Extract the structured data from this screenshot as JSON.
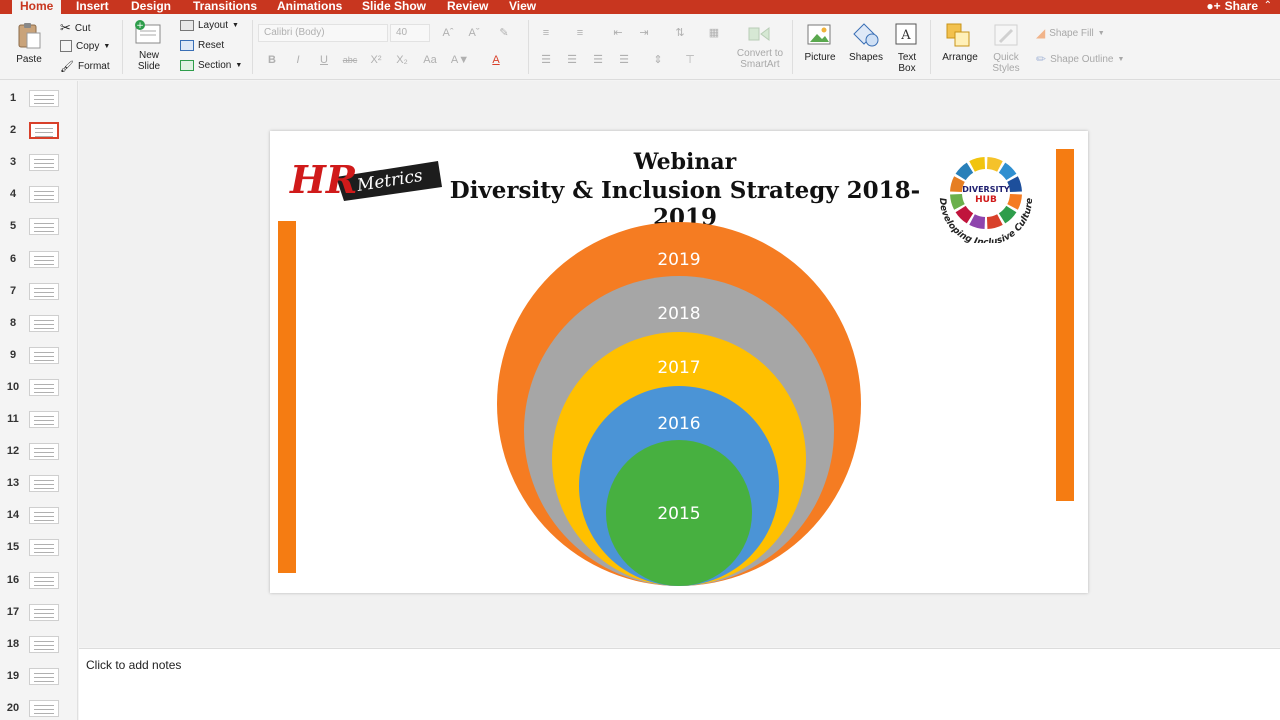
{
  "ribbon_tabs": [
    {
      "label": "Home",
      "active": true
    },
    {
      "label": "Insert"
    },
    {
      "label": "Design"
    },
    {
      "label": "Transitions"
    },
    {
      "label": "Animations"
    },
    {
      "label": "Slide Show"
    },
    {
      "label": "Review"
    },
    {
      "label": "View"
    }
  ],
  "share_label": "Share",
  "clipboard": {
    "paste": "Paste",
    "cut": "Cut",
    "copy": "Copy",
    "format": "Format"
  },
  "slides_group": {
    "new_slide": "New Slide",
    "layout": "Layout",
    "reset": "Reset",
    "section": "Section"
  },
  "font": {
    "name": "Calibri (Body)",
    "size": "40"
  },
  "format_buttons": [
    "B",
    "I",
    "U",
    "abc",
    "X²",
    "X₂"
  ],
  "convert_smartart": "Convert to SmartArt",
  "insert_group": {
    "picture": "Picture",
    "shapes": "Shapes",
    "text_box": "Text Box"
  },
  "drawing_group": {
    "arrange": "Arrange",
    "quick_styles": "Quick Styles",
    "shape_fill": "Shape Fill",
    "shape_outline": "Shape Outline"
  },
  "thumbnails": [
    "1",
    "2",
    "3",
    "4",
    "5",
    "6",
    "7",
    "8",
    "9",
    "10",
    "11",
    "12",
    "13",
    "14",
    "15",
    "16",
    "17",
    "18",
    "19",
    "20"
  ],
  "selected_slide": 2,
  "slide": {
    "title_line1": "Webinar",
    "title_line2": "Diversity & Inclusion Strategy 2018-2019",
    "logo_hr": {
      "big": "HR",
      "small": "Metrics"
    },
    "logo_hub": {
      "line1": "DIVERSITY",
      "line2": "HUB",
      "ring": "Developing Inclusive Culture"
    },
    "circles": [
      {
        "label": "2019",
        "color": "#f57c22"
      },
      {
        "label": "2018",
        "color": "#a6a6a6"
      },
      {
        "label": "2017",
        "color": "#ffc000"
      },
      {
        "label": "2016",
        "color": "#4b94d6"
      },
      {
        "label": "2015",
        "color": "#47b040"
      }
    ],
    "accent_color": "#f57c12"
  },
  "notes_placeholder": "Click to add notes"
}
